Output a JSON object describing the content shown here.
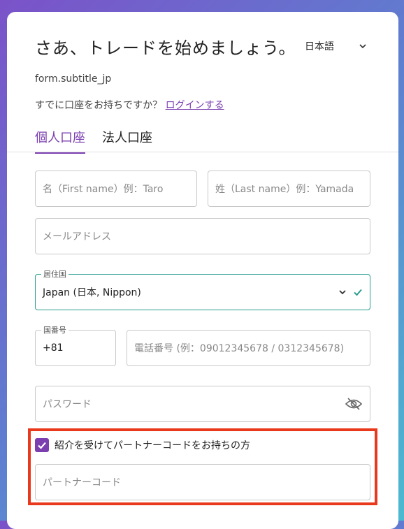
{
  "header": {
    "title": "さあ、トレードを始めましょう。",
    "language": "日本語",
    "subtitle": "form.subtitle_jp",
    "login_prompt": "すでに口座をお持ちですか？",
    "login_link": "ログインする"
  },
  "tabs": [
    {
      "label": "個人口座",
      "active": true
    },
    {
      "label": "法人口座",
      "active": false
    }
  ],
  "form": {
    "first_name_placeholder": "名（First name）例：Taro",
    "last_name_placeholder": "姓（Last name）例：Yamada",
    "email_placeholder": "メールアドレス",
    "country_label": "居住国",
    "country_value": "Japan (日本, Nippon)",
    "country_code_label": "国番号",
    "country_code_value": "+81",
    "phone_placeholder": "電話番号 (例：09012345678 / 0312345678)",
    "password_placeholder": "パスワード",
    "partner_checkbox_label": "紹介を受けてパートナーコードをお持ちの方",
    "partner_checkbox_checked": true,
    "partner_code_placeholder": "パートナーコード"
  },
  "colors": {
    "accent": "#7b3fb0",
    "valid": "#2a9d8f",
    "highlight": "#e8391c"
  }
}
